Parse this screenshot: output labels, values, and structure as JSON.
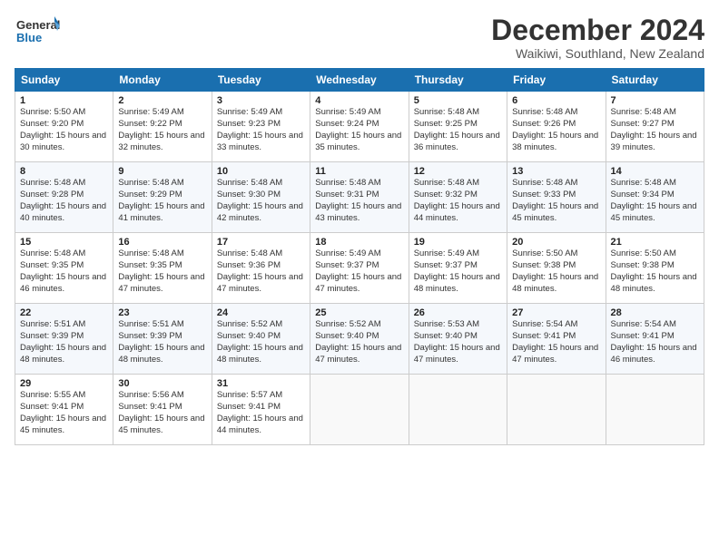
{
  "logo": {
    "line1": "General",
    "line2": "Blue"
  },
  "title": "December 2024",
  "subtitle": "Waikiwi, Southland, New Zealand",
  "days_of_week": [
    "Sunday",
    "Monday",
    "Tuesday",
    "Wednesday",
    "Thursday",
    "Friday",
    "Saturday"
  ],
  "weeks": [
    [
      {
        "day": "1",
        "sunrise": "5:50 AM",
        "sunset": "9:20 PM",
        "daylight": "15 hours and 30 minutes."
      },
      {
        "day": "2",
        "sunrise": "5:49 AM",
        "sunset": "9:22 PM",
        "daylight": "15 hours and 32 minutes."
      },
      {
        "day": "3",
        "sunrise": "5:49 AM",
        "sunset": "9:23 PM",
        "daylight": "15 hours and 33 minutes."
      },
      {
        "day": "4",
        "sunrise": "5:49 AM",
        "sunset": "9:24 PM",
        "daylight": "15 hours and 35 minutes."
      },
      {
        "day": "5",
        "sunrise": "5:48 AM",
        "sunset": "9:25 PM",
        "daylight": "15 hours and 36 minutes."
      },
      {
        "day": "6",
        "sunrise": "5:48 AM",
        "sunset": "9:26 PM",
        "daylight": "15 hours and 38 minutes."
      },
      {
        "day": "7",
        "sunrise": "5:48 AM",
        "sunset": "9:27 PM",
        "daylight": "15 hours and 39 minutes."
      }
    ],
    [
      {
        "day": "8",
        "sunrise": "5:48 AM",
        "sunset": "9:28 PM",
        "daylight": "15 hours and 40 minutes."
      },
      {
        "day": "9",
        "sunrise": "5:48 AM",
        "sunset": "9:29 PM",
        "daylight": "15 hours and 41 minutes."
      },
      {
        "day": "10",
        "sunrise": "5:48 AM",
        "sunset": "9:30 PM",
        "daylight": "15 hours and 42 minutes."
      },
      {
        "day": "11",
        "sunrise": "5:48 AM",
        "sunset": "9:31 PM",
        "daylight": "15 hours and 43 minutes."
      },
      {
        "day": "12",
        "sunrise": "5:48 AM",
        "sunset": "9:32 PM",
        "daylight": "15 hours and 44 minutes."
      },
      {
        "day": "13",
        "sunrise": "5:48 AM",
        "sunset": "9:33 PM",
        "daylight": "15 hours and 45 minutes."
      },
      {
        "day": "14",
        "sunrise": "5:48 AM",
        "sunset": "9:34 PM",
        "daylight": "15 hours and 45 minutes."
      }
    ],
    [
      {
        "day": "15",
        "sunrise": "5:48 AM",
        "sunset": "9:35 PM",
        "daylight": "15 hours and 46 minutes."
      },
      {
        "day": "16",
        "sunrise": "5:48 AM",
        "sunset": "9:35 PM",
        "daylight": "15 hours and 47 minutes."
      },
      {
        "day": "17",
        "sunrise": "5:48 AM",
        "sunset": "9:36 PM",
        "daylight": "15 hours and 47 minutes."
      },
      {
        "day": "18",
        "sunrise": "5:49 AM",
        "sunset": "9:37 PM",
        "daylight": "15 hours and 47 minutes."
      },
      {
        "day": "19",
        "sunrise": "5:49 AM",
        "sunset": "9:37 PM",
        "daylight": "15 hours and 48 minutes."
      },
      {
        "day": "20",
        "sunrise": "5:50 AM",
        "sunset": "9:38 PM",
        "daylight": "15 hours and 48 minutes."
      },
      {
        "day": "21",
        "sunrise": "5:50 AM",
        "sunset": "9:38 PM",
        "daylight": "15 hours and 48 minutes."
      }
    ],
    [
      {
        "day": "22",
        "sunrise": "5:51 AM",
        "sunset": "9:39 PM",
        "daylight": "15 hours and 48 minutes."
      },
      {
        "day": "23",
        "sunrise": "5:51 AM",
        "sunset": "9:39 PM",
        "daylight": "15 hours and 48 minutes."
      },
      {
        "day": "24",
        "sunrise": "5:52 AM",
        "sunset": "9:40 PM",
        "daylight": "15 hours and 48 minutes."
      },
      {
        "day": "25",
        "sunrise": "5:52 AM",
        "sunset": "9:40 PM",
        "daylight": "15 hours and 47 minutes."
      },
      {
        "day": "26",
        "sunrise": "5:53 AM",
        "sunset": "9:40 PM",
        "daylight": "15 hours and 47 minutes."
      },
      {
        "day": "27",
        "sunrise": "5:54 AM",
        "sunset": "9:41 PM",
        "daylight": "15 hours and 47 minutes."
      },
      {
        "day": "28",
        "sunrise": "5:54 AM",
        "sunset": "9:41 PM",
        "daylight": "15 hours and 46 minutes."
      }
    ],
    [
      {
        "day": "29",
        "sunrise": "5:55 AM",
        "sunset": "9:41 PM",
        "daylight": "15 hours and 45 minutes."
      },
      {
        "day": "30",
        "sunrise": "5:56 AM",
        "sunset": "9:41 PM",
        "daylight": "15 hours and 45 minutes."
      },
      {
        "day": "31",
        "sunrise": "5:57 AM",
        "sunset": "9:41 PM",
        "daylight": "15 hours and 44 minutes."
      },
      null,
      null,
      null,
      null
    ]
  ]
}
